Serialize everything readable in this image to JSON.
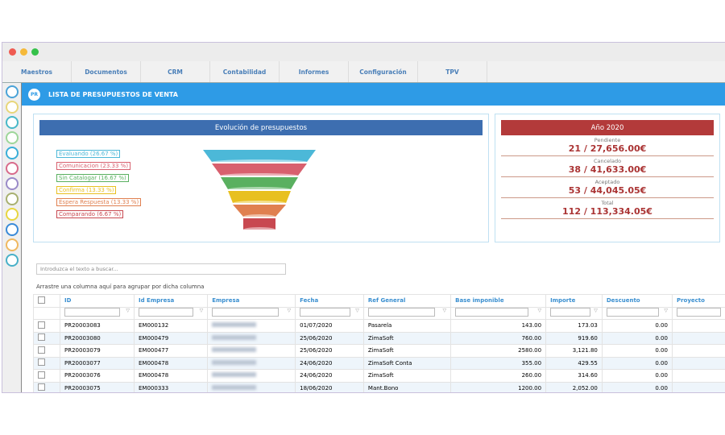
{
  "window": {
    "traffic_colors": [
      "#ef5b52",
      "#f5b93a",
      "#35c14a"
    ]
  },
  "menu": [
    "Maestros",
    "Documentos",
    "CRM",
    "Contabilidad",
    "Informes",
    "Configuración",
    "TPV"
  ],
  "sidebar": {
    "icon_colors": [
      "#4aa3d8",
      "#e8d67a",
      "#48b8c8",
      "#9ed69a",
      "#3aaed8",
      "#d86a8a",
      "#9a8ac8",
      "#a8b070",
      "#e8d640",
      "#3a8ad8",
      "#f0b860",
      "#48b0c8"
    ]
  },
  "header": {
    "badge": "PR",
    "title": "LISTA DE PRESUPUESTOS DE VENTA"
  },
  "funnel": {
    "title": "Evolución de presupuestos",
    "legend": [
      {
        "label": "Evaluando (26.67 %)",
        "color": "#4cb8d8"
      },
      {
        "label": "Comunicacion (23.33 %)",
        "color": "#d8606e"
      },
      {
        "label": "Sin Catalogar (16.67 %)",
        "color": "#5ab060"
      },
      {
        "label": "Confirma (13.33 %)",
        "color": "#e8c020"
      },
      {
        "label": "Espera Respuesta (13.33 %)",
        "color": "#e08050"
      },
      {
        "label": "Comparando (6.67 %)",
        "color": "#c84850"
      }
    ]
  },
  "kpi": {
    "title": "Año 2020",
    "items": [
      {
        "label": "Pendiente",
        "value": "21 / 27,656.00€"
      },
      {
        "label": "Cancelado",
        "value": "38 / 41,633.00€"
      },
      {
        "label": "Aceptado",
        "value": "53 / 44,045.05€"
      },
      {
        "label": "Total",
        "value": "112 / 113,334.05€"
      }
    ]
  },
  "grid": {
    "search_placeholder": "Introduzca el texto a buscar...",
    "group_hint": "Arrastre una columna aquí para agrupar por dicha columna",
    "columns": [
      "ID",
      "Id Empresa",
      "Empresa",
      "Fecha",
      "Ref General",
      "Base imponible",
      "Importe",
      "Descuento",
      "Proyecto"
    ],
    "rows": [
      [
        "PR20003083",
        "EM000132",
        "",
        "01/07/2020",
        "Pasarela",
        "143.00",
        "173.03",
        "0.00",
        ""
      ],
      [
        "PR20003080",
        "EM000479",
        "",
        "25/06/2020",
        "ZimaSoft",
        "760.00",
        "919.60",
        "0.00",
        ""
      ],
      [
        "PR20003079",
        "EM000477",
        "",
        "25/06/2020",
        "ZimaSoft",
        "2580.00",
        "3,121.80",
        "0.00",
        ""
      ],
      [
        "PR20003077",
        "EM000478",
        "",
        "24/06/2020",
        "ZimaSoft Conta",
        "355.00",
        "429.55",
        "0.00",
        ""
      ],
      [
        "PR20003076",
        "EM000478",
        "",
        "24/06/2020",
        "ZimaSoft",
        "260.00",
        "314.60",
        "0.00",
        ""
      ],
      [
        "PR20003075",
        "EM000333",
        "",
        "18/06/2020",
        "Mant.Bono",
        "1200.00",
        "2,052.00",
        "0.00",
        ""
      ]
    ]
  }
}
